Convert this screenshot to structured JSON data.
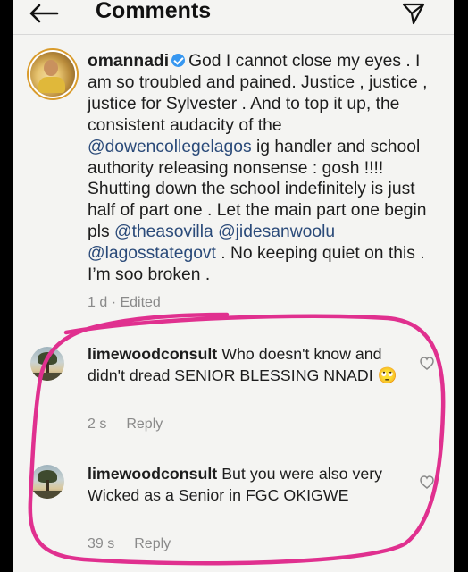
{
  "header": {
    "title": "Comments"
  },
  "main_comment": {
    "username": "omannadi",
    "segments": [
      {
        "text": "God I cannot close my eyes . I am so troubled and pained. Justice , justice , justice for Sylvester . And to top it up, the consistent audacity of the ",
        "mention": false
      },
      {
        "text": "@dowencollegelagos",
        "mention": true
      },
      {
        "text": " ig handler and school authority releasing nonsense : gosh !!!! Shutting down the school indefinitely is just half of part one . Let the main part one begin pls ",
        "mention": false
      },
      {
        "text": "@theasovilla",
        "mention": true
      },
      {
        "text": " ",
        "mention": false
      },
      {
        "text": "@jidesanwoolu",
        "mention": true
      },
      {
        "text": " ",
        "mention": false
      },
      {
        "text": "@lagosstategovt",
        "mention": true
      },
      {
        "text": " . No keeping quiet on this . I’m soo broken .",
        "mention": false
      }
    ],
    "meta": "1 d · Edited"
  },
  "replies": [
    {
      "username": "limewoodconsult",
      "text": "Who doesn't know and didn't dread SENIOR BLESSING NNADI 🙄",
      "time": "2 s",
      "reply_label": "Reply"
    },
    {
      "username": "limewoodconsult",
      "text": "But you were also very Wicked as a Senior in FGC OKIGWE",
      "time": "39 s",
      "reply_label": "Reply"
    }
  ],
  "icons": {
    "back": "arrow-left-icon",
    "send": "send-icon",
    "verified": "verified-badge-icon",
    "like": "heart-icon"
  },
  "colors": {
    "mention": "#2a4a79",
    "verified": "#3797f0",
    "annotation": "#e0308f",
    "meta": "#8a8a8a"
  }
}
